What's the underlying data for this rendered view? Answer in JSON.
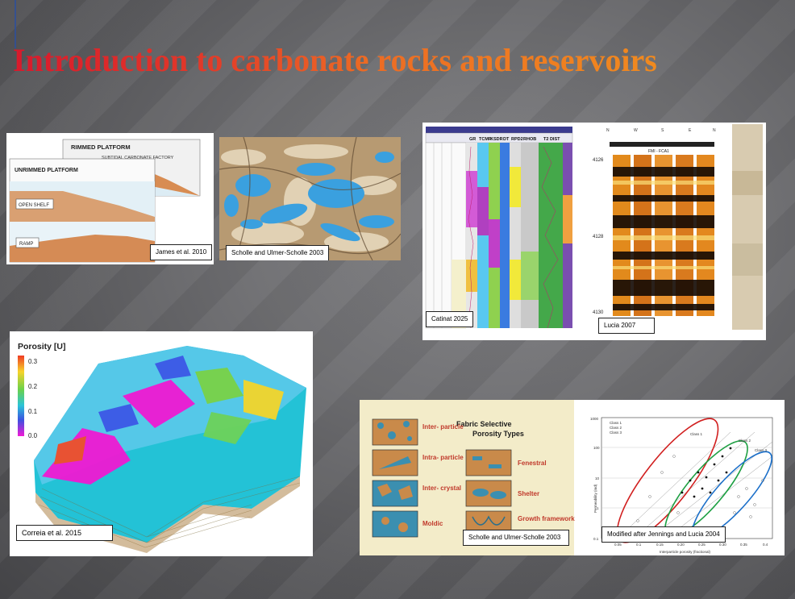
{
  "slide": {
    "title": "Introduction to carbonate rocks and reservoirs",
    "accent_colors": {
      "title_start": "#d8192c",
      "title_end": "#f08a1f",
      "background": "#6e6e71"
    }
  },
  "figures": {
    "platform": {
      "caption": "James et al. 2010",
      "labels": {
        "rimmed": "RIMMED PLATFORM",
        "subtidal": "SUBTIDAL CARBONATE FACTORY",
        "unrimmed": "UNRIMMED PLATFORM",
        "open_shelf": "OPEN SHELF",
        "ramp": "RAMP"
      }
    },
    "thin_section": {
      "caption": "Scholle and Ulmer-Scholle 2003"
    },
    "well_log": {
      "caption": "Catinat 2025",
      "tracks": [
        "GR",
        "TCMR",
        "KSDR",
        "DT",
        "RPD2",
        "RHOB",
        "T2 DIST"
      ]
    },
    "borehole_image": {
      "caption": "Lucia 2007",
      "compass": [
        "N",
        "W",
        "S",
        "E",
        "N"
      ],
      "header": "FMI - FCA1",
      "depths": [
        "4126",
        "4128",
        "4130"
      ]
    },
    "porosity_model": {
      "caption": "Correia et al. 2015",
      "legend_title": "Porosity [U]",
      "legend_ticks": [
        "0.3",
        "0.2",
        "0.1",
        "0.0"
      ]
    },
    "porosity_types": {
      "caption": "Scholle and Ulmer-Scholle 2003",
      "heading_1": "Fabric Selective",
      "heading_2": "Porosity Types",
      "left": [
        "Inter- particle",
        "Intra- particle",
        "Inter- crystal",
        "Moldic"
      ],
      "right": [
        "Fenestral",
        "Shelter",
        "Growth framework"
      ]
    },
    "permeability": {
      "caption": "Modified after Jennings and Lucia 2004",
      "legend": [
        "Class 1",
        "Class 2",
        "Class 3"
      ],
      "y_ticks": [
        "1000",
        "100",
        "10",
        "1",
        "0.1"
      ],
      "x_ticks": [
        "0.05",
        "0.1",
        "0.15",
        "0.20",
        "0.25",
        "0.30",
        "0.35",
        "0.4"
      ],
      "y_axis_label": "Permeability (md)",
      "x_axis_label": "Interparticle porosity (fractional)",
      "ellipse_labels": [
        "Class 1",
        "Class 2",
        "Class 3"
      ]
    }
  }
}
